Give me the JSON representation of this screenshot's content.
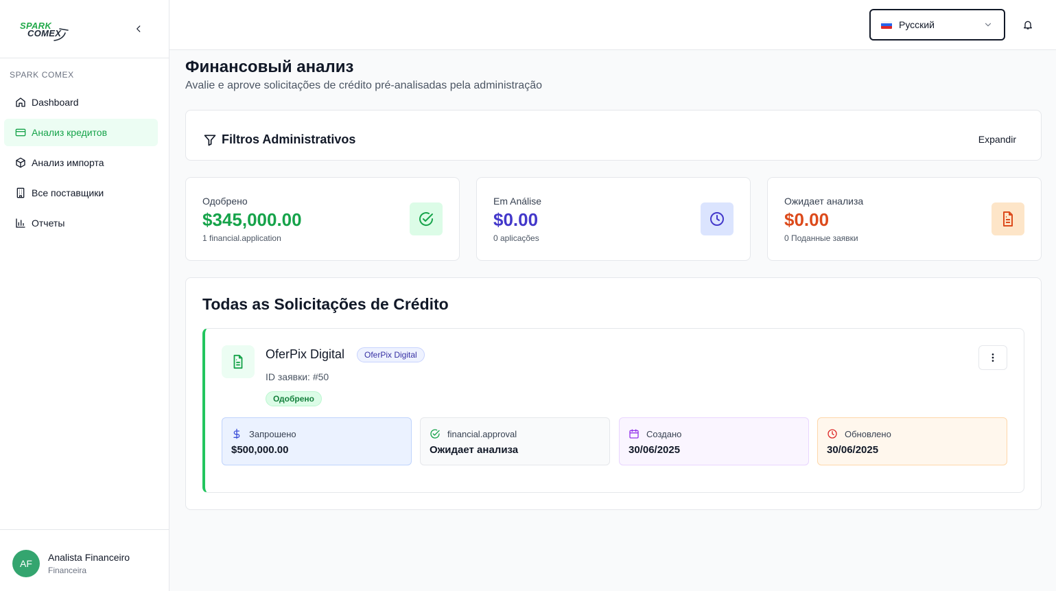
{
  "brand": {
    "line1": "SPARK",
    "line2": "COMEX"
  },
  "sidebar": {
    "section_label": "SPARK COMEX",
    "items": [
      {
        "label": "Dashboard",
        "icon": "home-icon"
      },
      {
        "label": "Анализ кредитов",
        "icon": "credit-card-icon",
        "active": true
      },
      {
        "label": "Анализ импорта",
        "icon": "package-icon"
      },
      {
        "label": "Все поставщики",
        "icon": "building-icon"
      },
      {
        "label": "Отчеты",
        "icon": "bar-chart-icon"
      }
    ]
  },
  "user": {
    "initials": "AF",
    "name": "Analista Financeiro",
    "role": "Financeira"
  },
  "header": {
    "language": "Русский"
  },
  "page": {
    "title": "Финансовый анализ",
    "subtitle": "Avalie e aprove solicitações de crédito pré-analisadas pela administração"
  },
  "filters": {
    "title": "Filtros Administrativos",
    "expand_label": "Expandir"
  },
  "stats": [
    {
      "label": "Одобрено",
      "value": "$345,000.00",
      "sub": "1 financial.application",
      "color": "#16a34a",
      "icon_bg": "#dcfce7",
      "icon": "check-circle-icon"
    },
    {
      "label": "Em Análise",
      "value": "$0.00",
      "sub": "0 aplicações",
      "color": "#4338ca",
      "icon_bg": "#dbe4fe",
      "icon": "clock-icon"
    },
    {
      "label": "Ожидает анализа",
      "value": "$0.00",
      "sub": "0 Поданные заявки",
      "color": "#dc4a1b",
      "icon_bg": "#fde5c8",
      "icon": "file-text-icon"
    }
  ],
  "list": {
    "title": "Todas as Solicitações de Crédito",
    "application": {
      "company": "OferPix Digital",
      "company_badge": "OferPix Digital",
      "request_id": "ID заявки: #50",
      "status": "Одобрено",
      "details": [
        {
          "label": "Запрошено",
          "value": "$500,000.00",
          "icon": "dollar-icon"
        },
        {
          "label": "financial.approval",
          "value": "Ожидает анализа",
          "icon": "check-circle-icon"
        },
        {
          "label": "Создано",
          "value": "30/06/2025",
          "icon": "calendar-icon"
        },
        {
          "label": "Обновлено",
          "value": "30/06/2025",
          "icon": "clock-icon"
        }
      ]
    }
  },
  "colors": {
    "accent": "#16a34a",
    "border": "#e5e7eb"
  }
}
